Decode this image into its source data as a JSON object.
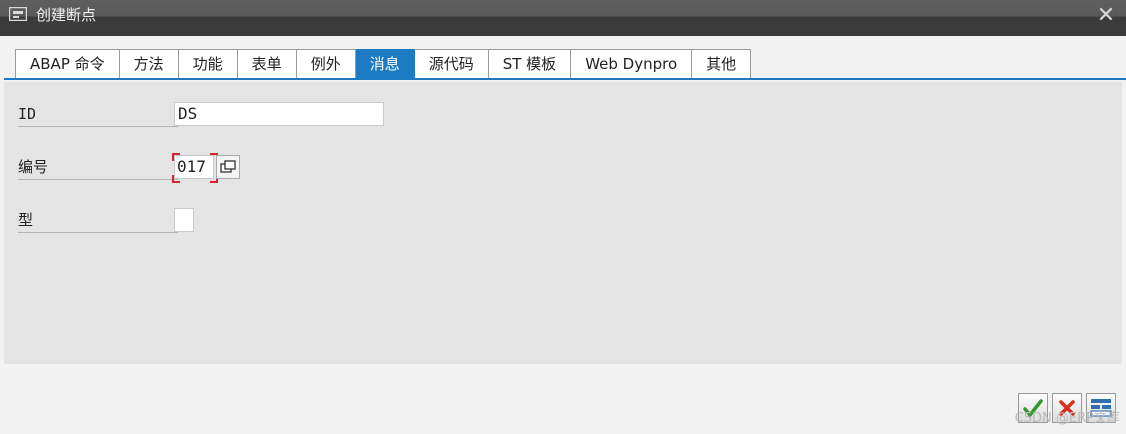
{
  "window": {
    "title": "创建断点"
  },
  "tabs": [
    {
      "label": "ABAP 命令"
    },
    {
      "label": "方法"
    },
    {
      "label": "功能"
    },
    {
      "label": "表单"
    },
    {
      "label": "例外"
    },
    {
      "label": "消息",
      "active": true
    },
    {
      "label": "源代码"
    },
    {
      "label": "ST 模板"
    },
    {
      "label": "Web Dynpro"
    },
    {
      "label": "其他"
    }
  ],
  "form": {
    "id": {
      "label": "ID",
      "value": "DS"
    },
    "number": {
      "label": "编号",
      "value": "017"
    },
    "type": {
      "label": "型",
      "value": ""
    }
  },
  "footer": {
    "watermark": "CSDN @ERP文库"
  },
  "icons": {
    "title": "window-icon",
    "close": "close-icon",
    "f4": "value-help-icon",
    "confirm": "checkmark-icon",
    "cancel": "cancel-icon",
    "layout": "layout-icon"
  },
  "colors": {
    "accent": "#1d7bc4",
    "focus_marker": "#d0282e",
    "confirm": "#2e9a2e",
    "cancel": "#d4301f"
  }
}
